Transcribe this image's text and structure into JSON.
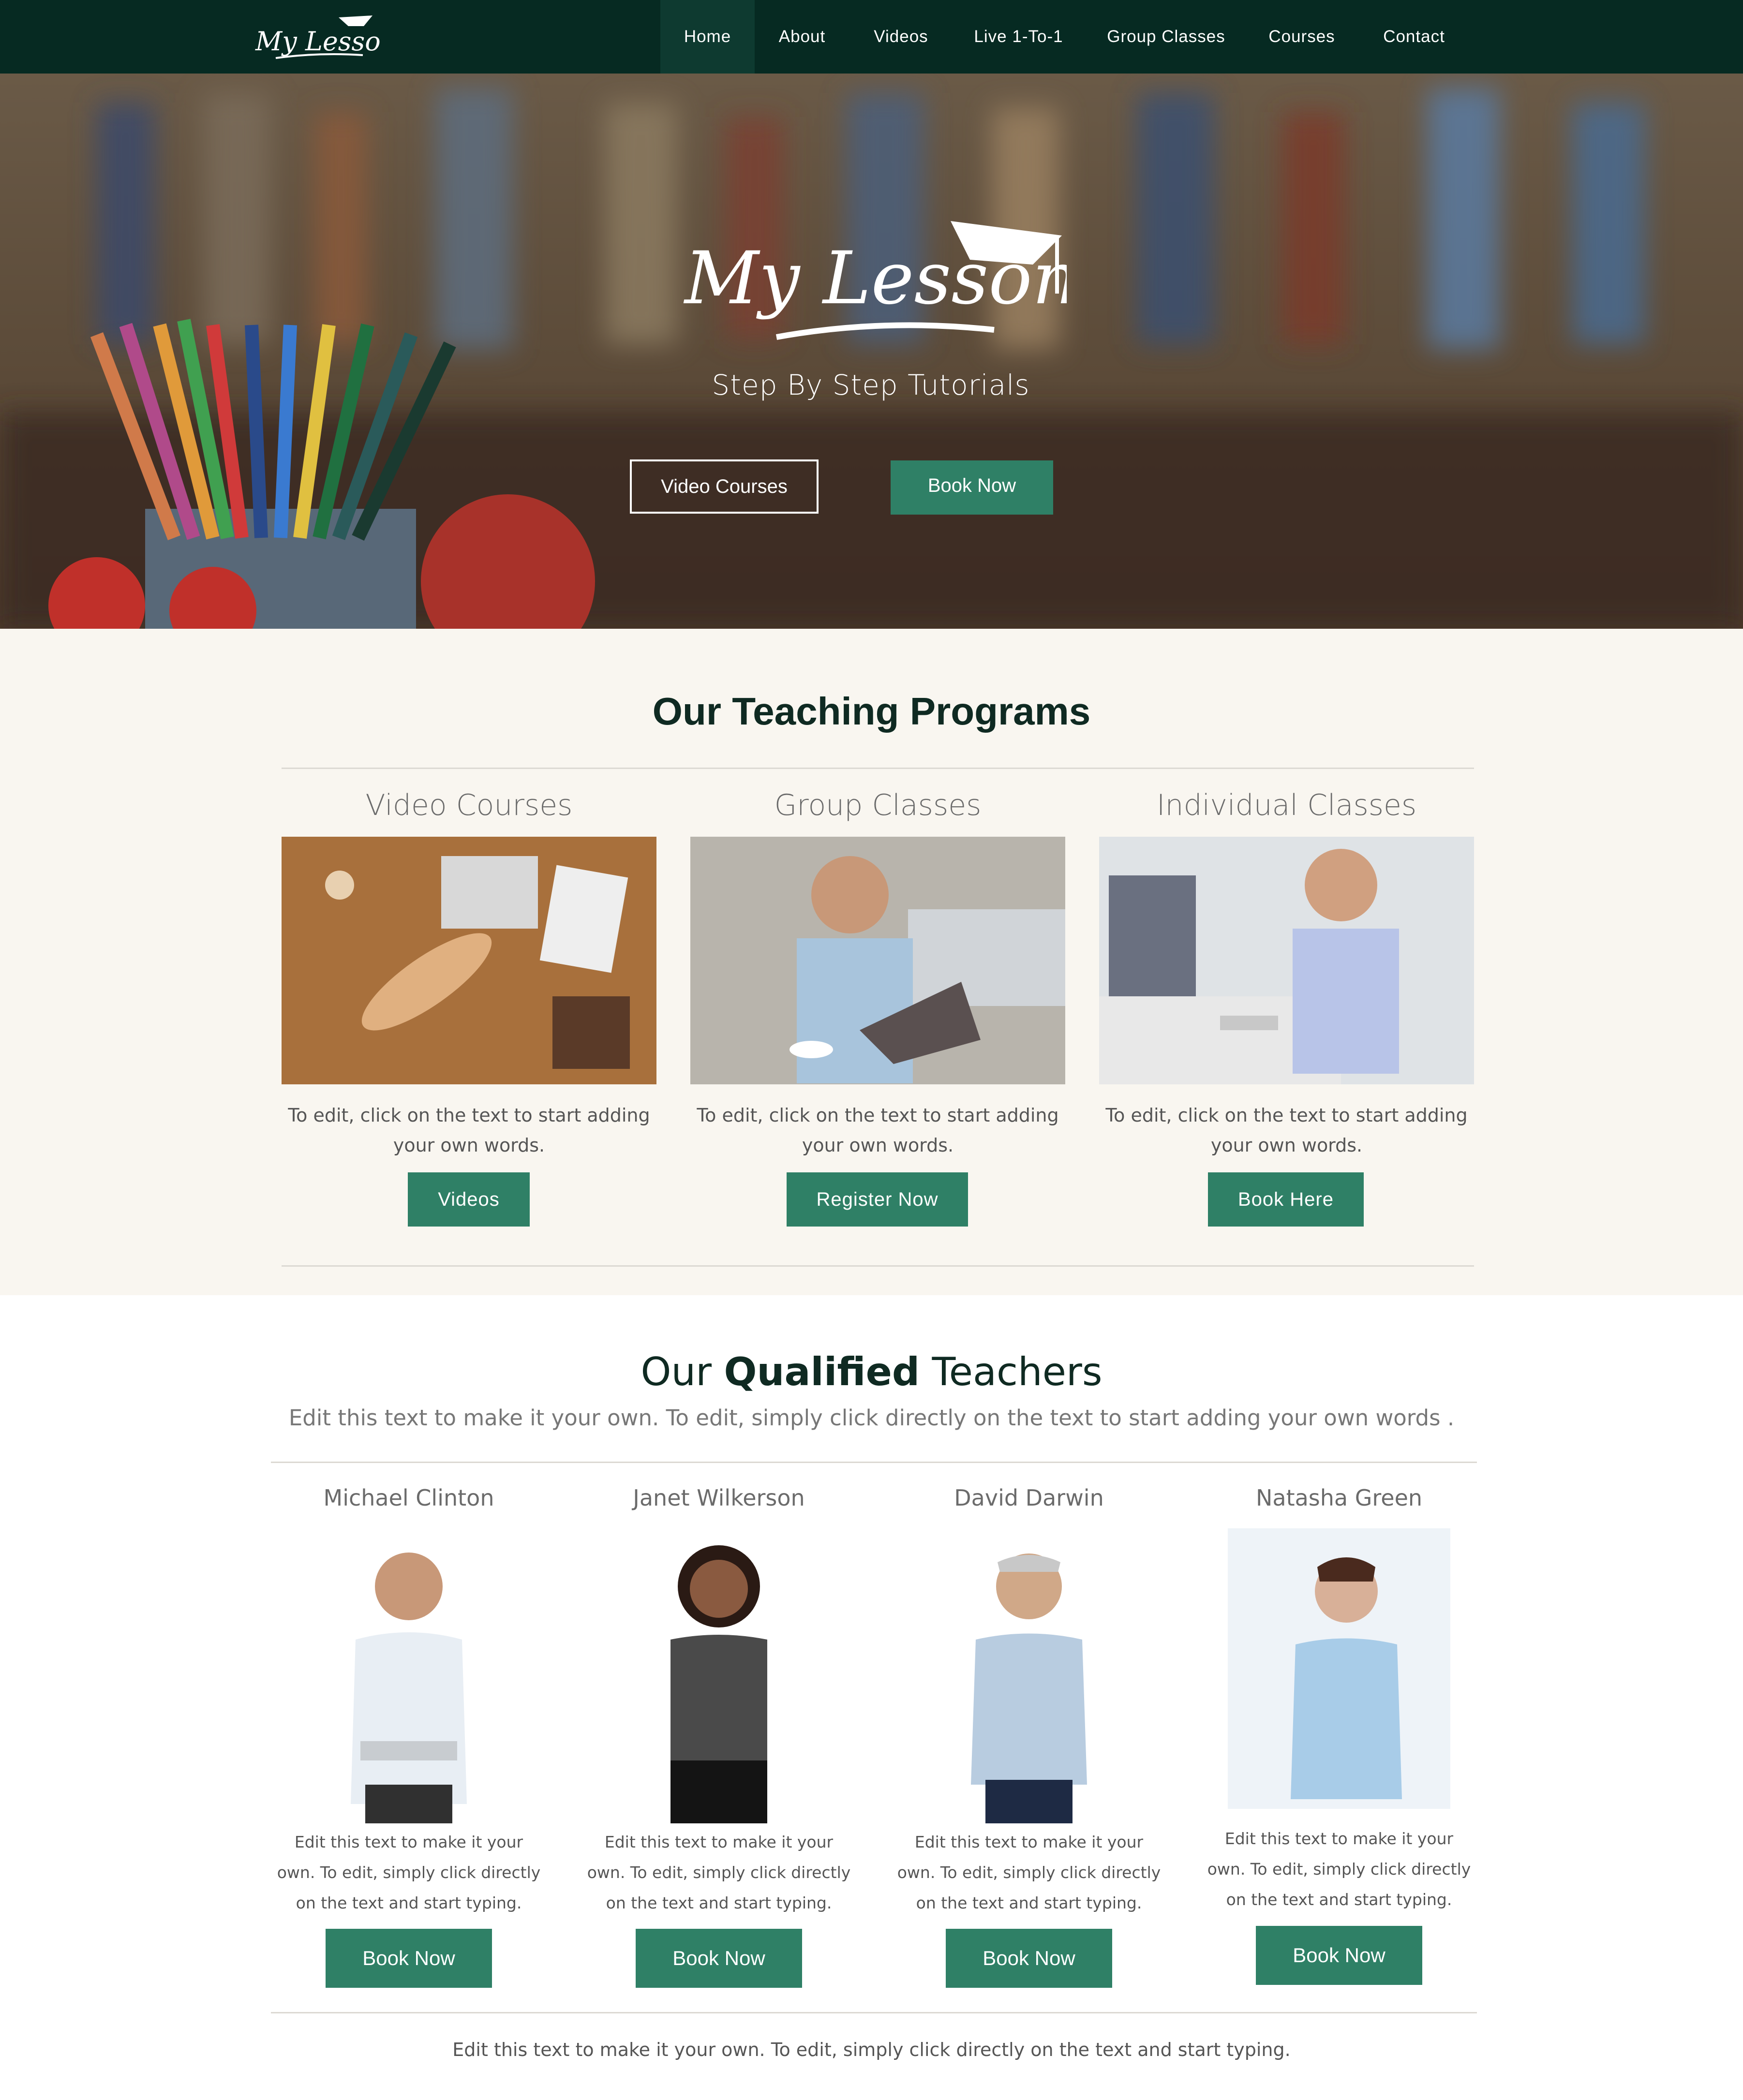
{
  "nav": {
    "logo_text": "My Lessons",
    "items": [
      "Home",
      "About",
      "Videos",
      "Live 1-To-1",
      "Group Classes",
      "Courses",
      "Contact"
    ],
    "active": "Home"
  },
  "hero": {
    "logo_text": "My Lessons",
    "tagline": "Step By Step Tutorials",
    "btn_video_courses": "Video Courses",
    "btn_book_now": "Book Now"
  },
  "programs": {
    "title": "Our Teaching Programs",
    "cards": [
      {
        "title": "Video Courses",
        "text": "To edit, click on the text to start adding your own words.",
        "button": "Videos"
      },
      {
        "title": "Group Classes",
        "text": "To edit, click on the text to start adding your own words.",
        "button": "Register Now"
      },
      {
        "title": "Individual Classes",
        "text": "To edit, click on the text to start adding your own words.",
        "button": "Book Here"
      }
    ]
  },
  "teachers": {
    "title_prefix": "Our ",
    "title_bold": "Qualified",
    "title_suffix": " Teachers",
    "subtitle": "Edit this text to make it your own. To edit, simply click directly on the text to start adding your own words .",
    "cards": [
      {
        "name": "Michael Clinton",
        "text": "Edit this text to make it your own. To edit, simply click directly on the text and start typing.",
        "button": "Book Now"
      },
      {
        "name": "Janet Wilkerson",
        "text": "Edit this text to make it your own. To edit, simply click directly on the text and start typing.",
        "button": "Book Now"
      },
      {
        "name": "David Darwin",
        "text": "Edit this text to make it your own. To edit, simply click directly on the text and start typing.",
        "button": "Book Now"
      },
      {
        "name": "Natasha Green",
        "text": "Edit this text to make it your own. To edit, simply click directly on the text and start typing.",
        "button": "Book Now"
      }
    ]
  },
  "footer_text": "Edit this text to make it your own. To edit, simply click directly on the text and start typing.",
  "colors": {
    "nav_bg": "#062a22",
    "accent": "#2f8066",
    "section_bg": "#f9f6f0",
    "heading": "#0f2a22"
  }
}
